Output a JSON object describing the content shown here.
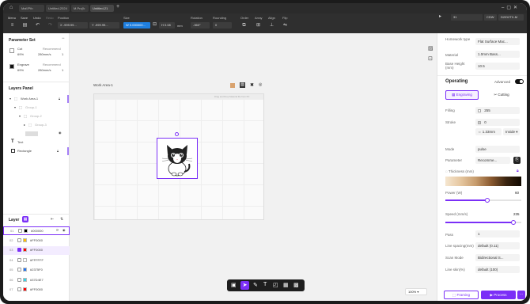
{
  "titlebar": {
    "tabs": [
      "Mat'/Pth",
      "Untitled-2024",
      "M.Proj'k",
      "Untitled-21"
    ],
    "add": "+"
  },
  "menubar": {
    "items": [
      "Menu",
      "Save",
      "Undo",
      "Redo",
      "Position",
      "Size",
      "Rotation",
      "Rounding",
      "Order",
      "Array",
      "Align",
      "Flip"
    ],
    "position_x": "-999.99...",
    "position_y": "-999.99...",
    "size_w": "0.000000...",
    "size_h": "0.08",
    "size_unit": "mm",
    "rotation": "-360°",
    "rounding": "0",
    "search_value": "31",
    "device_mode": "CDW",
    "device_name": "D2/D2TX-M"
  },
  "left": {
    "param_title": "Parameter Set",
    "param_rows": [
      {
        "name": "Cut",
        "tag": "Recommend",
        "a": "69%",
        "b": "280mm/s",
        "c": "1"
      },
      {
        "name": "Engrave",
        "tag": "Recommend",
        "a": "69%",
        "b": "280mm/s",
        "c": "1"
      }
    ],
    "layer_panel_title": "Layers Panel",
    "tree": [
      "Work Area-1",
      "Group-1",
      "Group-2",
      "Group-3",
      "",
      "Text",
      "Rectangle"
    ],
    "layer_title": "Layer",
    "layers": [
      {
        "num": "01",
        "name": "#000000",
        "color": "#000000"
      },
      {
        "num": "02",
        "name": "#FF0000",
        "color": "#FFC000"
      },
      {
        "num": "03",
        "name": "#FF0000",
        "color": "#FF0000"
      },
      {
        "num": "04",
        "name": "#FFFFFF",
        "color": "#FFFFFF"
      },
      {
        "num": "05",
        "name": "#2375F0",
        "color": "#2375F0"
      },
      {
        "num": "06",
        "name": "#37D4E7",
        "color": "#37D4E7"
      },
      {
        "num": "07",
        "name": "#FF0000",
        "color": "#FF0000"
      }
    ]
  },
  "canvas": {
    "workarea_label": "Work Area-1",
    "workarea_hint": "Drag and Drop Material file from PC",
    "zoom": "100%"
  },
  "right": {
    "homework_label": "Homework type",
    "homework_value": "Flat Surface Mac...",
    "material_label": "Material",
    "material_value": "1.0mm Bass...",
    "base_height_label": "Base Height (mm)",
    "base_height_value": "10.5",
    "operating_title": "Operating",
    "advanced_label": "Advanced",
    "tab_engraving": "Engraving",
    "tab_cutting": "Cutting",
    "filling_label": "Filling",
    "filling_value": "255",
    "stroke_label": "Stroke",
    "stroke_value": "0",
    "stroke_width": "1.33mm",
    "stroke_pos": "Inside",
    "mode_label": "Mode",
    "mode_value": "pulse",
    "parameter_label": "Parameter",
    "parameter_value": "Recomme...",
    "thickness_label": "Thickness (mm)",
    "power_label": "Power (W)",
    "power_value": "60",
    "power_fraction": 0.55,
    "speed_label": "Speed (mm/s)",
    "speed_value": "235",
    "speed_fraction": 0.9,
    "pass_label": "Pass",
    "pass_value": "1",
    "linespacing_label": "Line spacing(mm)",
    "linespacing_value": "default (0.11)",
    "scanmode_label": "Scan Mode",
    "scanmode_value": "Bidirectional S...",
    "lineskin_label": "Line skin(%)",
    "lineskin_value": "default (100)",
    "framing_label": "Framing",
    "process_label": "Process",
    "more": "..."
  }
}
